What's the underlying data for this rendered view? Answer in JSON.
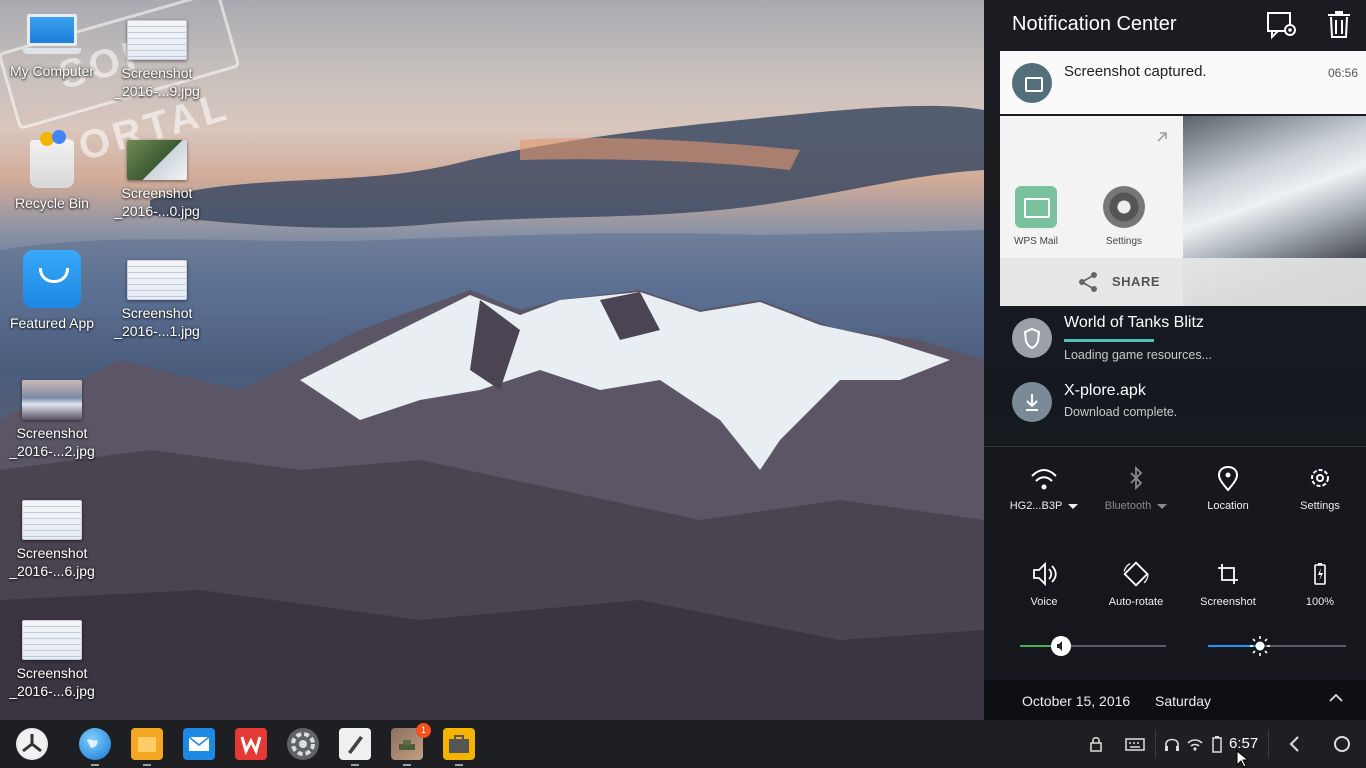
{
  "desktop": {
    "watermark": "SOFT PORTAL",
    "icons": [
      {
        "label": "My Computer"
      },
      {
        "label": "Recycle Bin"
      },
      {
        "label": "Featured App"
      },
      {
        "label": "Screenshot\n_2016-...2.jpg"
      },
      {
        "label": "Screenshot\n_2016-...6.jpg"
      },
      {
        "label": "Screenshot\n_2016-...6.jpg"
      },
      {
        "label": "Screenshot\n_2016-...9.jpg"
      },
      {
        "label": "Screenshot\n_2016-...0.jpg"
      },
      {
        "label": "Screenshot\n_2016-...1.jpg"
      }
    ]
  },
  "notification_center": {
    "title": "Notification Center",
    "header_icons": [
      "notification-settings-icon",
      "clear-all-trash-icon"
    ],
    "screenshot_notification": {
      "title": "Screenshot captured.",
      "time": "06:56",
      "share_apps": [
        {
          "label": "WPS Mail",
          "icon": "mail-icon"
        },
        {
          "label": "Settings",
          "icon": "gear-icon"
        }
      ],
      "share_label": "SHARE"
    },
    "notifications": [
      {
        "title": "World of Tanks Blitz",
        "subtitle": "Loading game resources...",
        "icon": "shield-icon",
        "progress": 0.39
      },
      {
        "title": "X-plore.apk",
        "subtitle": "Download complete.",
        "icon": "download-icon"
      }
    ],
    "quick_settings": [
      {
        "label": "HG2...B3P",
        "icon": "wifi-icon",
        "active": true,
        "dropdown": true
      },
      {
        "label": "Bluetooth",
        "icon": "bluetooth-icon",
        "active": false,
        "dropdown": true
      },
      {
        "label": "Location",
        "icon": "location-pin-icon",
        "active": true
      },
      {
        "label": "Settings",
        "icon": "gear-icon",
        "active": true
      },
      {
        "label": "Voice",
        "icon": "speaker-icon",
        "active": true
      },
      {
        "label": "Auto-rotate",
        "icon": "auto-rotate-icon",
        "active": true
      },
      {
        "label": "Screenshot",
        "icon": "crop-icon",
        "active": true
      },
      {
        "label": "100%",
        "icon": "battery-icon",
        "active": true
      }
    ],
    "volume_level": 0.28,
    "brightness_level": 0.38,
    "slider_colors": {
      "volume": "#4caf50",
      "brightness": "#2196f3"
    },
    "date": "October 15, 2016",
    "weekday": "Saturday"
  },
  "taskbar": {
    "apps": [
      {
        "name": "start-menu",
        "icon": "logo-icon"
      },
      {
        "name": "browser",
        "icon": "globe-icon"
      },
      {
        "name": "files",
        "icon": "folder-icon"
      },
      {
        "name": "mail",
        "icon": "mail-icon"
      },
      {
        "name": "wps-office",
        "icon": "wps-icon"
      },
      {
        "name": "settings",
        "icon": "gear-icon"
      },
      {
        "name": "notes",
        "icon": "pen-icon"
      },
      {
        "name": "game",
        "icon": "tank-game-icon",
        "badge": "1"
      },
      {
        "name": "tools",
        "icon": "toolbox-icon"
      }
    ],
    "clock": "6:57"
  }
}
